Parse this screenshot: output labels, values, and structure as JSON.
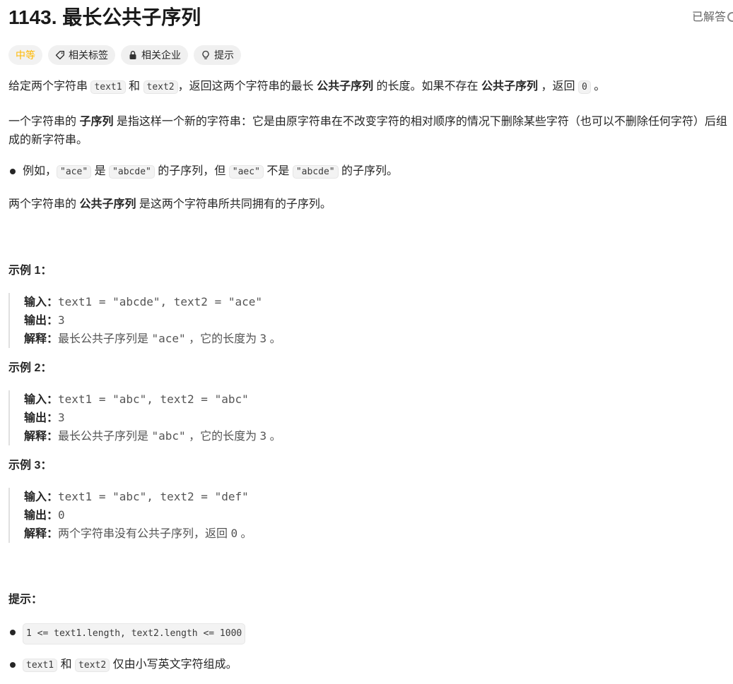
{
  "header": {
    "title": "1143. 最长公共子序列",
    "solved_label": "已解答"
  },
  "tags": [
    {
      "label": "中等",
      "icon": ""
    },
    {
      "label": "相关标签",
      "icon": "tag-icon"
    },
    {
      "label": "相关企业",
      "icon": "lock-icon"
    },
    {
      "label": "提示",
      "icon": "lightbulb-icon"
    }
  ],
  "description": {
    "p1": {
      "a": "给定两个字符串 ",
      "code1": "text1",
      "b": " 和 ",
      "code2": "text2",
      "c": "，返回这两个字符串的最长 ",
      "strong1": "公共子序列",
      "d": " 的长度。如果不存在 ",
      "strong2": "公共子序列",
      "e": " ，返回 ",
      "code3": "0",
      "f": " 。"
    },
    "p2": {
      "a": "一个字符串的 ",
      "strong": "子序列",
      "b": " 是指这样一个新的字符串：它是由原字符串在不改变字符的相对顺序的情况下删除某些字符（也可以不删除任何字符）后组成的新字符串。"
    },
    "bullet": {
      "a": "例如，",
      "code1": "\"ace\"",
      "b": " 是 ",
      "code2": "\"abcde\"",
      "c": " 的子序列，但 ",
      "code3": "\"aec\"",
      "d": " 不是 ",
      "code4": "\"abcde\"",
      "e": " 的子序列。"
    },
    "p3": {
      "a": "两个字符串的 ",
      "strong": "公共子序列",
      "b": " 是这两个字符串所共同拥有的子序列。"
    }
  },
  "examples": [
    {
      "title": "示例 1：",
      "input_label": "输入：",
      "input": "text1 = \"abcde\", text2 = \"ace\"",
      "output_label": "输出：",
      "output": "3",
      "explain_label": "解释：",
      "explain_a": "最长公共子序列是 ",
      "explain_code": "\"ace\"",
      "explain_b": " ，它的长度为 ",
      "explain_num": "3",
      "explain_c": " 。"
    },
    {
      "title": "示例 2：",
      "input_label": "输入：",
      "input": "text1 = \"abc\", text2 = \"abc\"",
      "output_label": "输出：",
      "output": "3",
      "explain_label": "解释：",
      "explain_a": "最长公共子序列是 ",
      "explain_code": "\"abc\"",
      "explain_b": " ，它的长度为 ",
      "explain_num": "3",
      "explain_c": " 。"
    },
    {
      "title": "示例 3：",
      "input_label": "输入：",
      "input": "text1 = \"abc\", text2 = \"def\"",
      "output_label": "输出：",
      "output": "0",
      "explain_label": "解释：",
      "explain_a": "两个字符串没有公共子序列，返回 ",
      "explain_code": "",
      "explain_b": "",
      "explain_num": "0",
      "explain_c": " 。"
    }
  ],
  "constraints": {
    "title": "提示：",
    "items": [
      {
        "code": "1 <= text1.length, text2.length <= 1000"
      },
      {
        "code1": "text1",
        "a": " 和 ",
        "code2": "text2",
        "b": " 仅由小写英文字符组成。"
      }
    ]
  }
}
